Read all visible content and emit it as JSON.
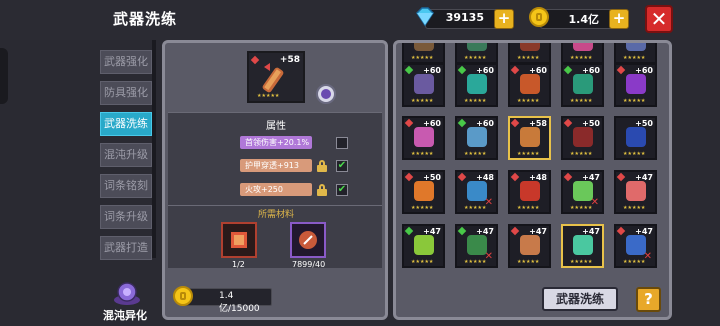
{
  "header": {
    "title": "武器洗练",
    "gems": "39135",
    "gold": "1.4亿",
    "plus": "+",
    "close": "✕"
  },
  "sidebar": {
    "items": [
      {
        "label": "武器强化"
      },
      {
        "label": "防具强化"
      },
      {
        "label": "武器洗练"
      },
      {
        "label": "混沌升级"
      },
      {
        "label": "词条铭刻"
      },
      {
        "label": "词条升级"
      },
      {
        "label": "武器打造"
      }
    ],
    "active_index": 2,
    "chaos_label": "混沌异化"
  },
  "left": {
    "weapon_level": "+58",
    "attributes_title": "属性",
    "attributes": [
      {
        "text": "首领伤害+20.1%",
        "locked": false,
        "checked": false
      },
      {
        "text": "护甲穿透+913",
        "locked": true,
        "checked": true
      },
      {
        "text": "火攻+250",
        "locked": true,
        "checked": true
      }
    ],
    "materials_title": "所需材料",
    "materials": [
      {
        "count": "1/2"
      },
      {
        "count": "7899/40"
      }
    ],
    "gold_cost": "1.4亿/15000"
  },
  "grid": {
    "cells": [
      {
        "lv": "",
        "color": "#7a5a3a"
      },
      {
        "lv": "",
        "color": "#3a7a5a"
      },
      {
        "lv": "",
        "color": "#8a3a2a"
      },
      {
        "lv": "",
        "color": "#c84a8a"
      },
      {
        "lv": "",
        "color": "#5a6aa8"
      },
      {
        "lv": "+60",
        "color": "#6a5aa0",
        "gem": "g"
      },
      {
        "lv": "+60",
        "color": "#2aa89a",
        "gem": "g"
      },
      {
        "lv": "+60",
        "color": "#c8582a",
        "gem": "r"
      },
      {
        "lv": "+60",
        "color": "#2a9a7a",
        "gem": "g"
      },
      {
        "lv": "+60",
        "color": "#8a3ac8",
        "gem": "r"
      },
      {
        "lv": "+60",
        "color": "#c85ab0",
        "gem": "r"
      },
      {
        "lv": "+60",
        "color": "#5a9ac8",
        "gem": "g"
      },
      {
        "lv": "+58",
        "color": "#c87a3a",
        "gem": "r",
        "sel": true
      },
      {
        "lv": "+50",
        "color": "#8a2a2a",
        "gem": "r"
      },
      {
        "lv": "+50",
        "color": "#2a4ab0",
        "gem": ""
      },
      {
        "lv": "+50",
        "color": "#e0782a",
        "gem": "r"
      },
      {
        "lv": "+48",
        "color": "#3a8ac8",
        "gem": "r",
        "x": true
      },
      {
        "lv": "+48",
        "color": "#c8382a",
        "gem": "r"
      },
      {
        "lv": "+47",
        "color": "#6ac85a",
        "gem": "r",
        "x": true
      },
      {
        "lv": "+47",
        "color": "#e06a6a",
        "gem": "r"
      },
      {
        "lv": "+47",
        "color": "#8ac83a",
        "gem": "g"
      },
      {
        "lv": "+47",
        "color": "#3a8a4a",
        "gem": "g",
        "x": true
      },
      {
        "lv": "+47",
        "color": "#c87a4a",
        "gem": "r"
      },
      {
        "lv": "+47",
        "color": "#4ac8a0",
        "gem": "",
        "sel": true
      },
      {
        "lv": "+47",
        "color": "#3a6ac8",
        "gem": "r",
        "x": true
      }
    ],
    "stars": "★★★★★"
  },
  "buttons": {
    "refine": "武器洗练",
    "help": "?"
  }
}
